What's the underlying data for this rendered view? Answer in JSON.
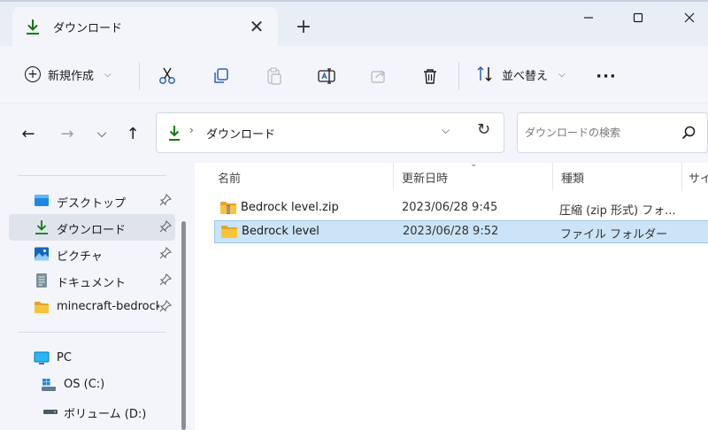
{
  "window": {
    "tab_title": "ダウンロード",
    "tab_close": "✕",
    "new_tab": "+",
    "minimize": "—",
    "maximize": "☐",
    "close": "✕"
  },
  "commandbar": {
    "new_label": "新規作成",
    "sort_label": "並べ替え",
    "more_label": "···",
    "dropdown_chevron": "⌵"
  },
  "address": {
    "separator": "›",
    "path": "ダウンロード",
    "dropdown": "⌵",
    "refresh": "↻"
  },
  "search": {
    "placeholder": "ダウンロードの検索"
  },
  "nav": {
    "back": "←",
    "forward": "→",
    "recent": "⌵",
    "up": "↑"
  },
  "sidebar": {
    "items": [
      {
        "label": "デスクトップ",
        "icon": "desktop-icon",
        "pinned": true
      },
      {
        "label": "ダウンロード",
        "icon": "download-icon",
        "pinned": true,
        "selected": true
      },
      {
        "label": "ピクチャ",
        "icon": "pictures-icon",
        "pinned": true
      },
      {
        "label": "ドキュメント",
        "icon": "documents-icon",
        "pinned": true
      },
      {
        "label": "minecraft-bedrock",
        "icon": "folder-icon",
        "pinned": true
      }
    ],
    "devices": [
      {
        "label": "PC",
        "icon": "pc-icon"
      },
      {
        "label": "OS (C:)",
        "icon": "drive-icon"
      },
      {
        "label": "ボリューム (D:)",
        "icon": "volume-icon"
      }
    ]
  },
  "list": {
    "columns": [
      "名前",
      "更新日時",
      "種類",
      "サイ"
    ],
    "sort_indicator": "⌄",
    "rows": [
      {
        "name": "Bedrock level.zip",
        "date": "2023/06/28 9:45",
        "type": "圧縮 (zip 形式) フォ...",
        "icon": "zip-folder-icon",
        "selected": false
      },
      {
        "name": "Bedrock level",
        "date": "2023/06/28 9:52",
        "type": "ファイル フォルダー",
        "icon": "folder-icon",
        "selected": true
      }
    ]
  },
  "colors": {
    "accent": "#0f7b0f",
    "folder": "#f8c43c",
    "folder_dark": "#e2a52a",
    "selection": "#cce4f7",
    "chrome": "#f3f5fa"
  }
}
